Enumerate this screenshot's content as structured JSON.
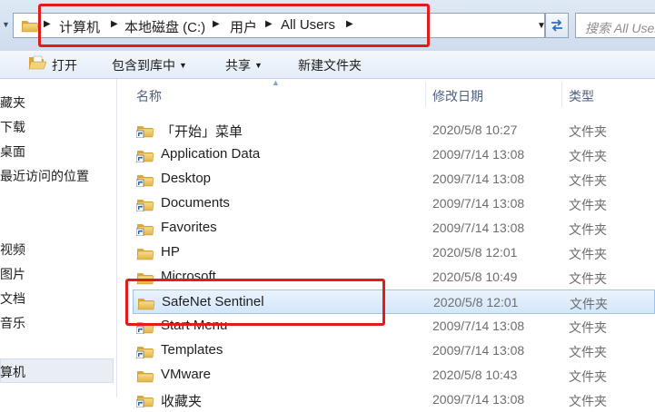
{
  "address_bar": {
    "breadcrumbs": [
      "计算机",
      "本地磁盘 (C:)",
      "用户",
      "All Users"
    ],
    "search_placeholder": "搜索 All Users"
  },
  "toolbar": {
    "open_label": "打开",
    "include_in_library_label": "包含到库中",
    "share_label": "共享",
    "new_folder_label": "新建文件夹"
  },
  "sidebar": {
    "items": [
      "藏夹",
      "下载",
      "桌面",
      "最近访问的位置",
      "视频",
      "图片",
      "文档",
      "音乐",
      "算机"
    ]
  },
  "columns": {
    "name": "名称",
    "date_modified": "修改日期",
    "type": "类型"
  },
  "rows": [
    {
      "name": "「开始」菜单",
      "date": "2020/5/8 10:27",
      "type": "文件夹",
      "icon": "shortcut-folder-icon"
    },
    {
      "name": "Application Data",
      "date": "2009/7/14 13:08",
      "type": "文件夹",
      "icon": "shortcut-folder-icon"
    },
    {
      "name": "Desktop",
      "date": "2009/7/14 13:08",
      "type": "文件夹",
      "icon": "shortcut-folder-icon"
    },
    {
      "name": "Documents",
      "date": "2009/7/14 13:08",
      "type": "文件夹",
      "icon": "shortcut-folder-icon"
    },
    {
      "name": "Favorites",
      "date": "2009/7/14 13:08",
      "type": "文件夹",
      "icon": "shortcut-folder-icon"
    },
    {
      "name": "HP",
      "date": "2020/5/8 12:01",
      "type": "文件夹",
      "icon": "folder-icon"
    },
    {
      "name": "Microsoft",
      "date": "2020/5/8 10:49",
      "type": "文件夹",
      "icon": "folder-icon"
    },
    {
      "name": "SafeNet Sentinel",
      "date": "2020/5/8 12:01",
      "type": "文件夹",
      "icon": "folder-icon"
    },
    {
      "name": "Start Menu",
      "date": "2009/7/14 13:08",
      "type": "文件夹",
      "icon": "shortcut-folder-icon"
    },
    {
      "name": "Templates",
      "date": "2009/7/14 13:08",
      "type": "文件夹",
      "icon": "shortcut-folder-icon"
    },
    {
      "name": "VMware",
      "date": "2020/5/8 10:43",
      "type": "文件夹",
      "icon": "folder-icon"
    },
    {
      "name": "收藏夹",
      "date": "2009/7/14 13:08",
      "type": "文件夹",
      "icon": "shortcut-folder-icon"
    }
  ],
  "colors": {
    "highlight_box": "#e21b1b",
    "selected_row": "#d3e6fb",
    "folder_yellow": "#e8c35a"
  }
}
